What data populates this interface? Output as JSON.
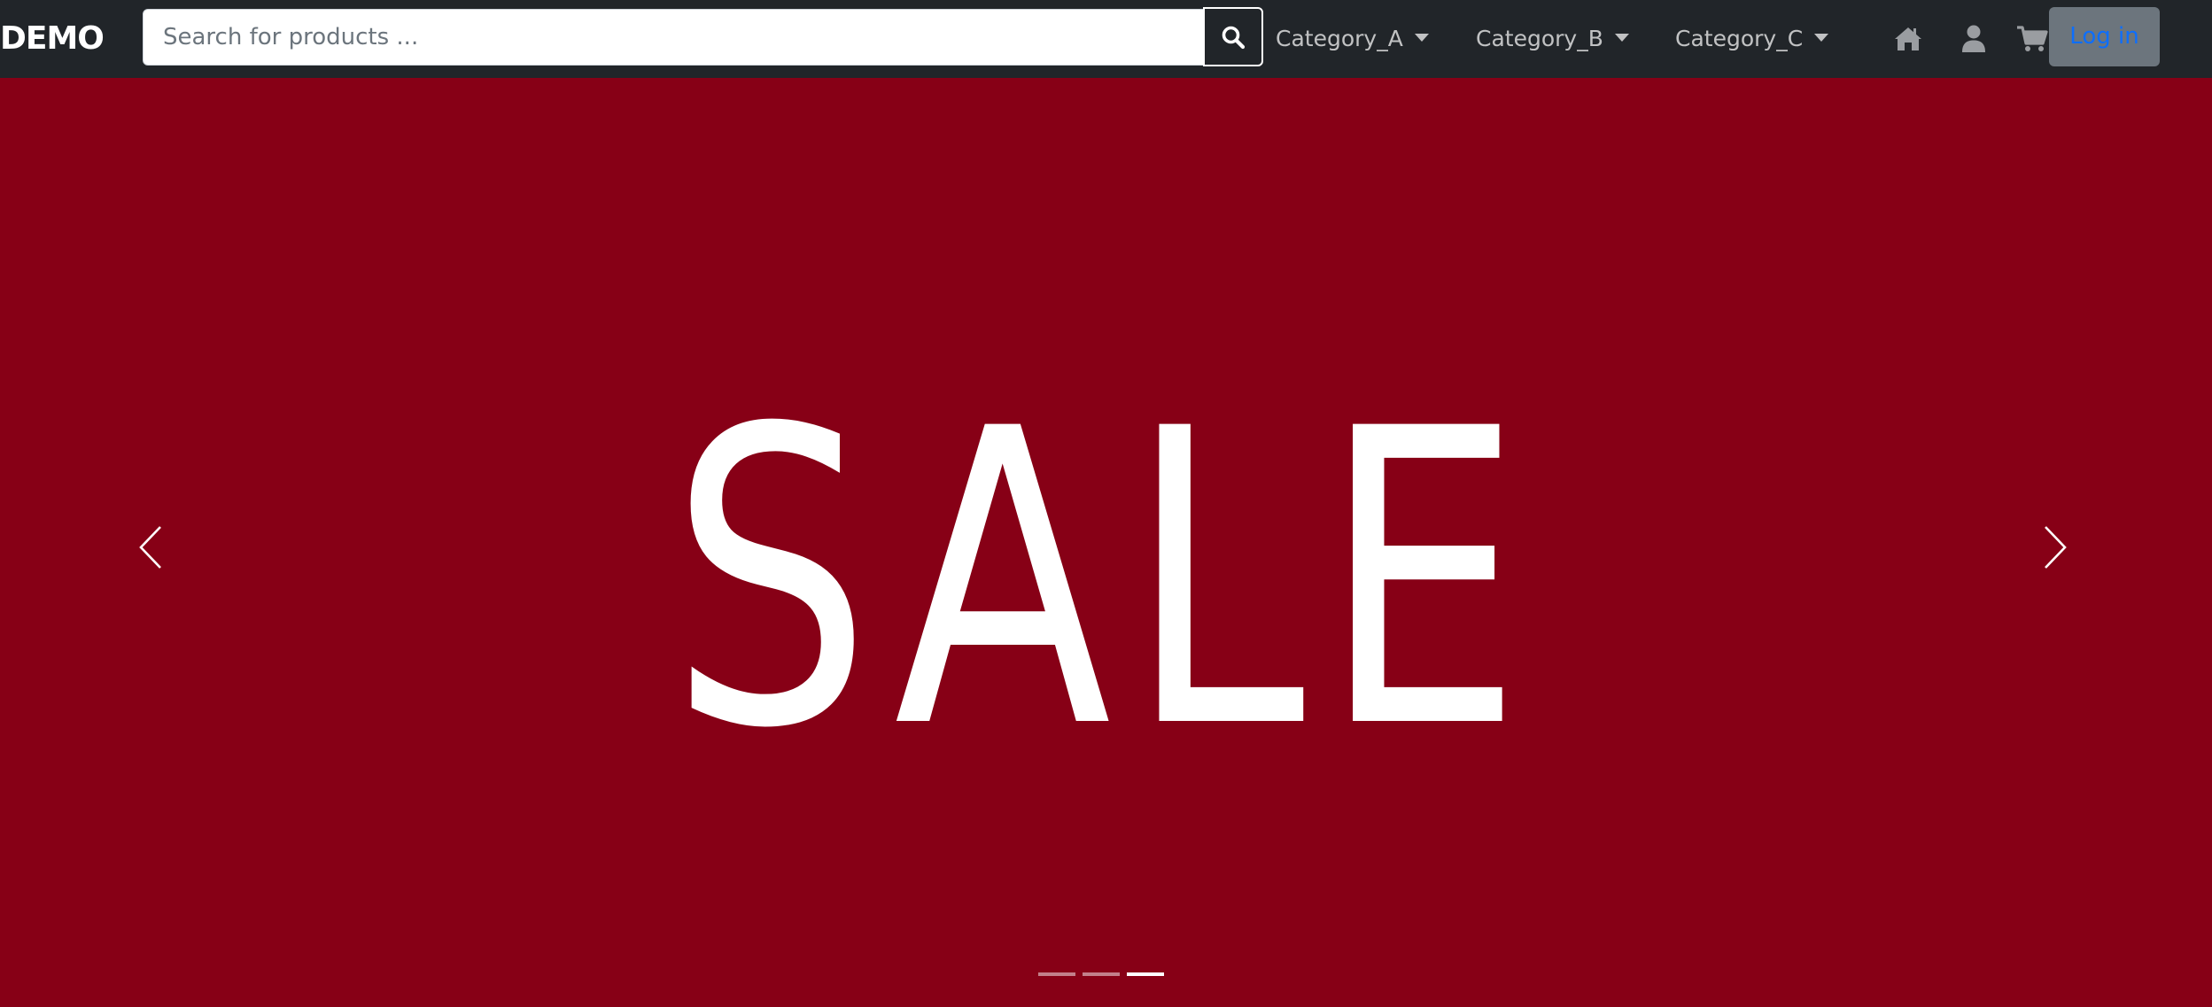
{
  "navbar": {
    "brand": "DEMO",
    "search": {
      "placeholder": "Search for products ...",
      "value": "",
      "button_icon": "search-icon"
    },
    "categories": [
      {
        "label": "Category_A"
      },
      {
        "label": "Category_B"
      },
      {
        "label": "Category_C"
      }
    ],
    "icons": [
      "home-icon",
      "user-icon",
      "cart-icon"
    ],
    "login_label": "Log in"
  },
  "carousel": {
    "slide_text": "SALE",
    "background_color": "#870016",
    "slide_count": 3,
    "active_slide": 3
  },
  "colors": {
    "navbar_bg": "#212529",
    "login_bg": "#6c757d",
    "login_text": "#0d6efd"
  }
}
